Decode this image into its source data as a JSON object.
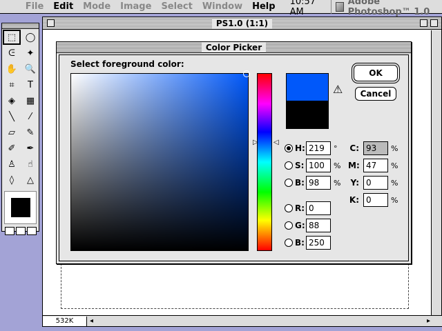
{
  "menubar": {
    "items": [
      "File",
      "Edit",
      "Mode",
      "Image",
      "Select",
      "Window",
      "Help"
    ],
    "active_items": [
      "Edit",
      "Help"
    ],
    "clock": "10:57 AM",
    "app_name": "Adobe Photoshop™ 1.0"
  },
  "tools": {
    "items": [
      {
        "name": "rectangle-marquee-tool",
        "glyph": "⬚"
      },
      {
        "name": "ellipse-marquee-tool",
        "glyph": "◯"
      },
      {
        "name": "lasso-tool",
        "glyph": "ᕮ"
      },
      {
        "name": "magic-wand-tool",
        "glyph": "✦"
      },
      {
        "name": "hand-tool",
        "glyph": "✋"
      },
      {
        "name": "zoom-tool",
        "glyph": "🔍"
      },
      {
        "name": "crop-tool",
        "glyph": "⌗"
      },
      {
        "name": "type-tool",
        "glyph": "T"
      },
      {
        "name": "paint-bucket-tool",
        "glyph": "◈"
      },
      {
        "name": "gradient-tool",
        "glyph": "▦"
      },
      {
        "name": "line-tool",
        "glyph": "╲"
      },
      {
        "name": "eyedropper-tool",
        "glyph": "⁄"
      },
      {
        "name": "eraser-tool",
        "glyph": "▱"
      },
      {
        "name": "pencil-tool",
        "glyph": "✎"
      },
      {
        "name": "airbrush-tool",
        "glyph": "✐"
      },
      {
        "name": "paintbrush-tool",
        "glyph": "✒"
      },
      {
        "name": "rubber-stamp-tool",
        "glyph": "♙"
      },
      {
        "name": "smudge-tool",
        "glyph": "☝"
      },
      {
        "name": "blur-tool",
        "glyph": "◊"
      },
      {
        "name": "sharpen-tool",
        "glyph": "△"
      }
    ]
  },
  "document": {
    "title": "PS1.0 (1:1)",
    "size_readout": "532K"
  },
  "dialog": {
    "title": "Color Picker",
    "prompt": "Select foreground color:",
    "ok_label": "OK",
    "cancel_label": "Cancel",
    "new_color": "#0058fa",
    "old_color": "#000000",
    "hsb": [
      {
        "label": "H:",
        "value": "219",
        "unit": "°",
        "checked": true
      },
      {
        "label": "S:",
        "value": "100",
        "unit": "%",
        "checked": false
      },
      {
        "label": "B:",
        "value": "98",
        "unit": "%",
        "checked": false
      }
    ],
    "rgb": [
      {
        "label": "R:",
        "value": "0"
      },
      {
        "label": "G:",
        "value": "88"
      },
      {
        "label": "B:",
        "value": "250"
      }
    ],
    "cmyk": [
      {
        "label": "C:",
        "value": "93",
        "unit": "%"
      },
      {
        "label": "M:",
        "value": "47",
        "unit": "%"
      },
      {
        "label": "Y:",
        "value": "0",
        "unit": "%"
      },
      {
        "label": "K:",
        "value": "0",
        "unit": "%"
      }
    ]
  }
}
